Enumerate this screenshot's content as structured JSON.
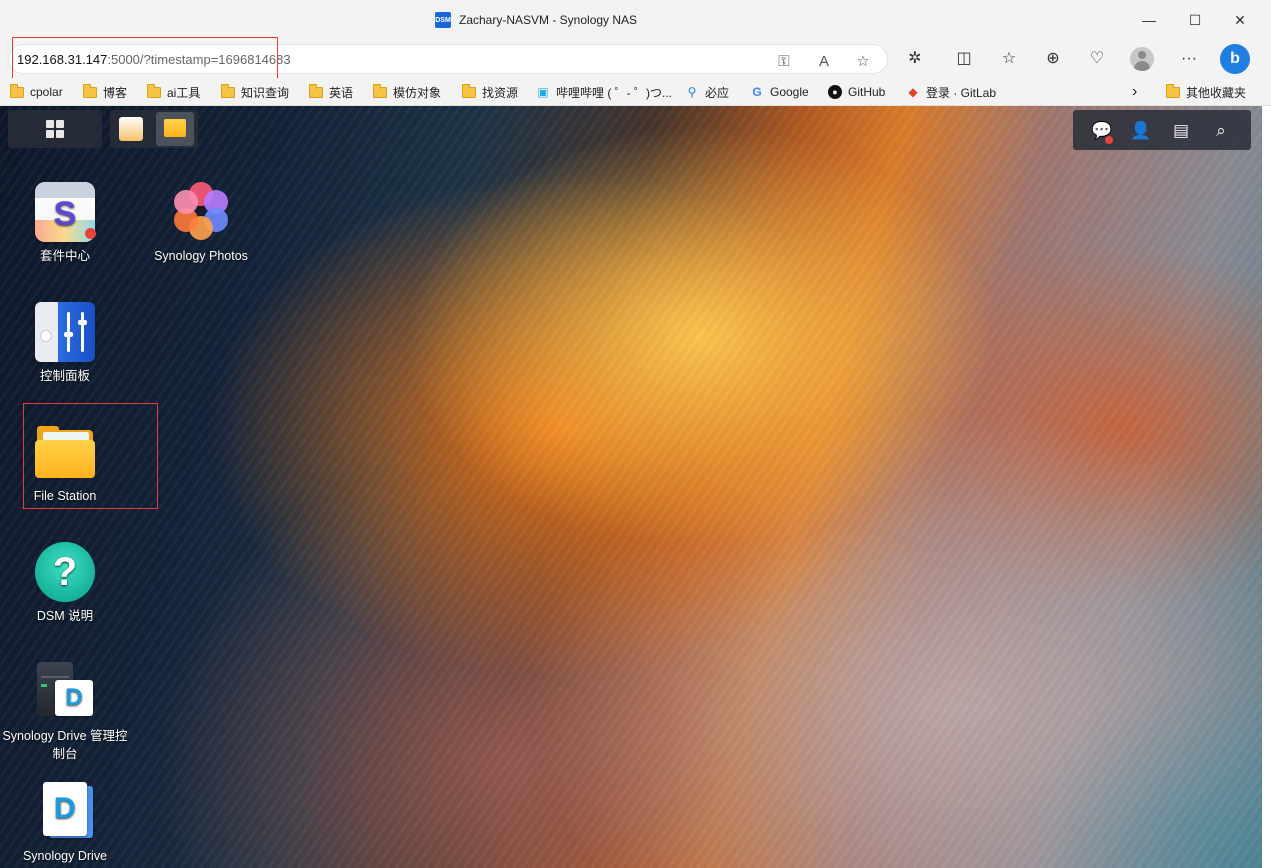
{
  "window": {
    "title": "Zachary-NASVM - Synology NAS",
    "tab_badge": "DSM",
    "controls": {
      "minimize": "—",
      "maximize": "☐",
      "close": "✕"
    }
  },
  "address_bar": {
    "host": "192.168.31.147",
    "rest": ":5000/?timestamp=1696814683"
  },
  "toolbar_icons": [
    "key-icon",
    "read-aloud-icon",
    "favorite-star-icon",
    "extensions-icon",
    "split-screen-icon",
    "favorites-icon",
    "collections-icon",
    "browser-essentials-icon",
    "profile-icon",
    "more-icon",
    "bing-icon"
  ],
  "bookmarks": {
    "items": [
      {
        "label": "cpolar",
        "icon": "folder"
      },
      {
        "label": "博客",
        "icon": "folder"
      },
      {
        "label": "ai工具",
        "icon": "folder"
      },
      {
        "label": "知识查询",
        "icon": "folder"
      },
      {
        "label": "英语",
        "icon": "folder"
      },
      {
        "label": "模仿对象",
        "icon": "folder"
      },
      {
        "label": "找资源",
        "icon": "folder"
      },
      {
        "label": "哔哩哔哩 ( ゜- ゜)つ...",
        "icon": "bilibili"
      },
      {
        "label": "必应",
        "icon": "search"
      },
      {
        "label": "Google",
        "icon": "google"
      },
      {
        "label": "GitHub",
        "icon": "github"
      },
      {
        "label": "登录 · GitLab",
        "icon": "gitlab"
      }
    ],
    "overflow": "›",
    "other_favorites": "其他收藏夹"
  },
  "desktop": {
    "apps": [
      {
        "label": "套件中心"
      },
      {
        "label": "Synology Photos"
      },
      {
        "label": "控制面板"
      },
      {
        "label": "File Station"
      },
      {
        "label": "DSM 说明"
      },
      {
        "label": "Synology Drive 管理控制台"
      },
      {
        "label": "Synology Drive"
      }
    ],
    "help_glyph": "?",
    "pkg_glyph": "S",
    "drive_glyph": "D"
  },
  "colors": {
    "highlight": "#e23b3b",
    "dsm_blue": "#1766d6",
    "notification": "#e8433a"
  }
}
